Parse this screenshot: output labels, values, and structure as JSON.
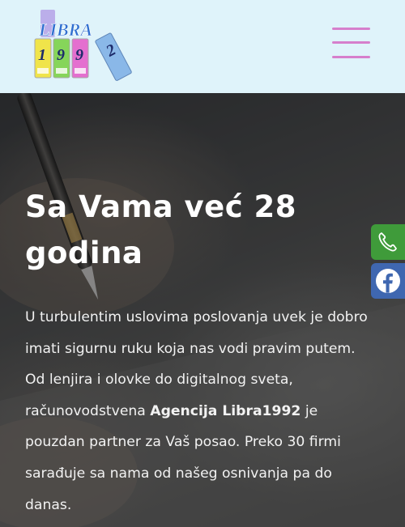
{
  "header": {
    "logo_text": "LIBRA",
    "logo_digits": [
      "1",
      "9",
      "9",
      "2"
    ],
    "menu_icon": "hamburger-menu-icon"
  },
  "hero": {
    "title": "Sa Vama već 28 godina",
    "paragraph_part1": "U turbulentim uslovima poslovanja uvek je dobro imati sigurnu ruku koja nas vodi pravim putem. Od lenjira i olovke do digitalnog sveta, računovodstvena ",
    "paragraph_bold": "Agencija Libra1992",
    "paragraph_part2": " je pouzdan partner za Vaš posao. Preko 30 firmi sarađuje sa nama od našeg osnivanja pa do danas."
  },
  "side_buttons": [
    {
      "icon": "phone-icon",
      "color": "#3f9b3a"
    },
    {
      "icon": "facebook-icon",
      "color": "#3f67b0"
    }
  ],
  "colors": {
    "header_bg": "#dff3fa",
    "menu_icon": "#d67fcc",
    "logo_blue": "#2f6fd0",
    "binder_yellow": "#f0e44a",
    "binder_green": "#86d55a",
    "binder_pink": "#e46fcf",
    "binder_blue": "#8ab8e8"
  }
}
